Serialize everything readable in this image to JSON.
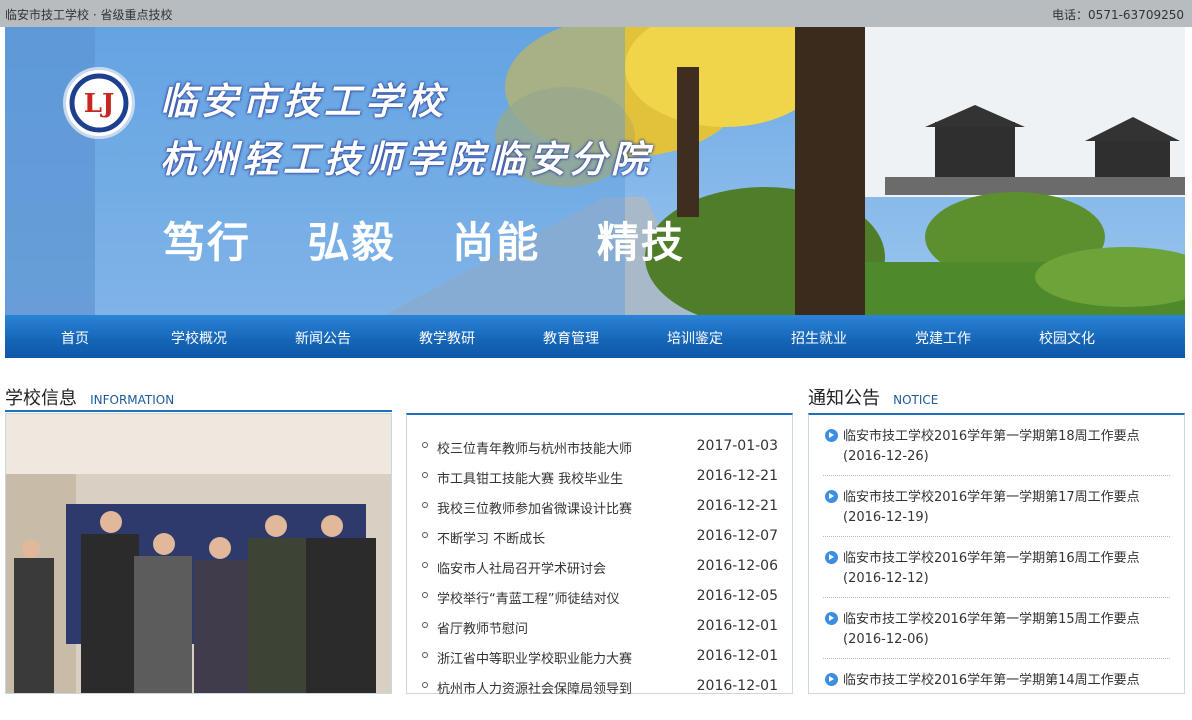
{
  "topbar": {
    "left": "临安市技工学校 · 省级重点技校",
    "right": "电话：0571-63709250"
  },
  "banner": {
    "title_line1": "临安市技工学校",
    "title_line2": "杭州轻工技师学院临安分院",
    "slogan": [
      "笃行",
      "弘毅",
      "尚能",
      "精技"
    ]
  },
  "nav": {
    "items": [
      "首页",
      "学校概况",
      "新闻公告",
      "教学教研",
      "教育管理",
      "培训鉴定",
      "招生就业",
      "党建工作",
      "校园文化"
    ]
  },
  "school_info": {
    "title_cn": "学校信息",
    "title_en": "INFORMATION",
    "news": [
      {
        "title": "校三位青年教师与杭州市技能大师",
        "date": "2017-01-03"
      },
      {
        "title": "市工具钳工技能大赛 我校毕业生",
        "date": "2016-12-21"
      },
      {
        "title": "我校三位教师参加省微课设计比赛",
        "date": "2016-12-21"
      },
      {
        "title": "不断学习 不断成长",
        "date": "2016-12-07"
      },
      {
        "title": "临安市人社局召开学术研讨会",
        "date": "2016-12-06"
      },
      {
        "title": "学校举行“青蓝工程”师徒结对仪",
        "date": "2016-12-05"
      },
      {
        "title": "省厅教师节慰问",
        "date": "2016-12-01"
      },
      {
        "title": "浙江省中等职业学校职业能力大赛",
        "date": "2016-12-01"
      },
      {
        "title": "杭州市人力资源社会保障局领导到",
        "date": "2016-12-01"
      }
    ]
  },
  "notice": {
    "title_cn": "通知公告",
    "title_en": "NOTICE",
    "items": [
      {
        "title": "临安市技工学校2016学年第一学期第18周工作要点",
        "date": "(2016-12-26)"
      },
      {
        "title": "临安市技工学校2016学年第一学期第17周工作要点",
        "date": "(2016-12-19)"
      },
      {
        "title": "临安市技工学校2016学年第一学期第16周工作要点",
        "date": "(2016-12-12)"
      },
      {
        "title": "临安市技工学校2016学年第一学期第15周工作要点",
        "date": "(2016-12-06)"
      },
      {
        "title": "临安市技工学校2016学年第一学期第14周工作要点",
        "date": ""
      }
    ]
  },
  "colors": {
    "nav_blue": "#1565b7",
    "topbar_gray": "#b7bcc0",
    "accent_blue": "#1f6fbf"
  }
}
